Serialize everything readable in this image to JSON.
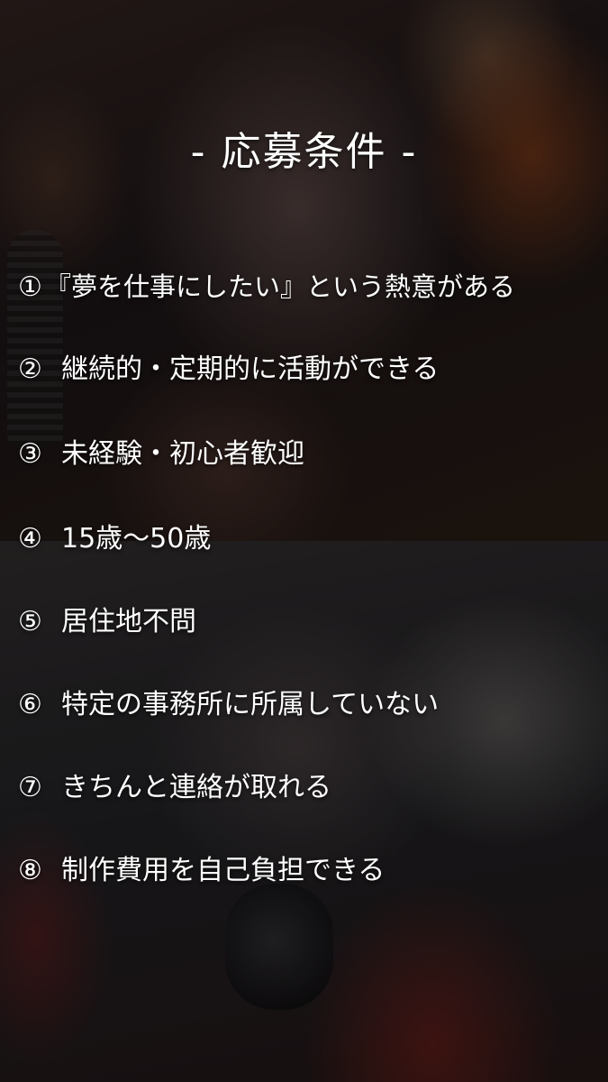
{
  "title": "- 応募条件 -",
  "conditions": [
    {
      "num": "①",
      "text": "『夢を仕事にしたい』という熱意がある"
    },
    {
      "num": "②",
      "text": "継続的・定期的に活動ができる"
    },
    {
      "num": "③",
      "text": "未経験・初心者歓迎"
    },
    {
      "num": "④",
      "text": "15歳～50歳"
    },
    {
      "num": "⑤",
      "text": "居住地不問"
    },
    {
      "num": "⑥",
      "text": "特定の事務所に所属していない"
    },
    {
      "num": "⑦",
      "text": "きちんと連絡が取れる"
    },
    {
      "num": "⑧",
      "text": "制作費用を自己負担できる"
    }
  ]
}
